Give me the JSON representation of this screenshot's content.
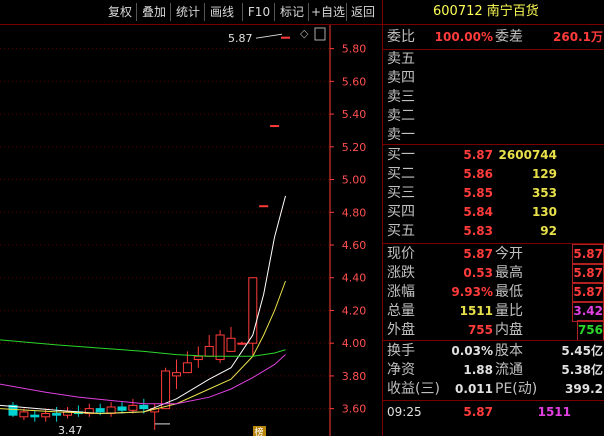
{
  "toolbar": {
    "buttons": [
      "复权",
      "叠加",
      "统计",
      "画线",
      "F10",
      "标记",
      "+自选",
      "返回"
    ]
  },
  "chart": {
    "y_ticks": [
      "5.80",
      "5.60",
      "5.40",
      "5.20",
      "5.00",
      "4.80",
      "4.60",
      "4.40",
      "4.20",
      "4.00",
      "3.80",
      "3.60"
    ],
    "high_label": "5.87",
    "low_label": "3.47",
    "bottom_marker": "榜",
    "colors": {
      "up": "#ff3b3b",
      "down": "#00d2d2",
      "ma1": "#ffffff",
      "ma2": "#e8e04a",
      "ma3": "#e040e0",
      "ma4": "#2bd62b",
      "axis": "#ff3b3b"
    }
  },
  "chart_data": {
    "type": "candlestick",
    "ylim": [
      3.5,
      5.92
    ],
    "candles": [
      {
        "o": 3.62,
        "c": 3.56,
        "h": 3.64,
        "l": 3.55
      },
      {
        "o": 3.55,
        "c": 3.58,
        "h": 3.6,
        "l": 3.53
      },
      {
        "o": 3.56,
        "c": 3.55,
        "h": 3.59,
        "l": 3.52
      },
      {
        "o": 3.55,
        "c": 3.57,
        "h": 3.6,
        "l": 3.52
      },
      {
        "o": 3.57,
        "c": 3.56,
        "h": 3.61,
        "l": 3.52
      },
      {
        "o": 3.56,
        "c": 3.58,
        "h": 3.61,
        "l": 3.54
      },
      {
        "o": 3.58,
        "c": 3.57,
        "h": 3.62,
        "l": 3.55
      },
      {
        "o": 3.57,
        "c": 3.6,
        "h": 3.63,
        "l": 3.55
      },
      {
        "o": 3.6,
        "c": 3.58,
        "h": 3.63,
        "l": 3.56
      },
      {
        "o": 3.57,
        "c": 3.61,
        "h": 3.64,
        "l": 3.55
      },
      {
        "o": 3.61,
        "c": 3.59,
        "h": 3.64,
        "l": 3.57
      },
      {
        "o": 3.59,
        "c": 3.62,
        "h": 3.66,
        "l": 3.57
      },
      {
        "o": 3.62,
        "c": 3.6,
        "h": 3.66,
        "l": 3.57
      },
      {
        "o": 3.58,
        "c": 3.6,
        "h": 3.63,
        "l": 3.47
      },
      {
        "o": 3.6,
        "c": 3.83,
        "h": 3.85,
        "l": 3.6
      },
      {
        "o": 3.8,
        "c": 3.82,
        "h": 3.9,
        "l": 3.72
      },
      {
        "o": 3.82,
        "c": 3.88,
        "h": 3.95,
        "l": 3.82
      },
      {
        "o": 3.9,
        "c": 3.92,
        "h": 3.98,
        "l": 3.85
      },
      {
        "o": 3.92,
        "c": 3.98,
        "h": 4.05,
        "l": 3.92
      },
      {
        "o": 3.9,
        "c": 4.05,
        "h": 4.08,
        "l": 3.88
      },
      {
        "o": 3.95,
        "c": 4.03,
        "h": 4.1,
        "l": 3.95
      },
      {
        "o": 4.0,
        "c": 4.0,
        "h": 4.01,
        "l": 3.99
      },
      {
        "o": 4.0,
        "c": 4.4,
        "h": 4.4,
        "l": 3.92
      },
      {
        "o": 4.84,
        "c": 4.84,
        "h": 4.84,
        "l": 4.84
      },
      {
        "o": 5.33,
        "c": 5.33,
        "h": 5.33,
        "l": 5.33
      },
      {
        "o": 5.87,
        "c": 5.87,
        "h": 5.87,
        "l": 5.87
      }
    ]
  },
  "quote": {
    "code": "600712",
    "name": "南宁百货",
    "weibi_label": "委比",
    "weibi": "100.00%",
    "weicha_label": "委差",
    "weicha": "260.1万",
    "sells": [
      {
        "label": "卖五",
        "price": "",
        "vol": ""
      },
      {
        "label": "卖四",
        "price": "",
        "vol": ""
      },
      {
        "label": "卖三",
        "price": "",
        "vol": ""
      },
      {
        "label": "卖二",
        "price": "",
        "vol": ""
      },
      {
        "label": "卖一",
        "price": "",
        "vol": ""
      }
    ],
    "buys": [
      {
        "label": "买一",
        "price": "5.87",
        "vol": "2600744"
      },
      {
        "label": "买二",
        "price": "5.86",
        "vol": "129"
      },
      {
        "label": "买三",
        "price": "5.85",
        "vol": "353"
      },
      {
        "label": "买四",
        "price": "5.84",
        "vol": "130"
      },
      {
        "label": "买五",
        "price": "5.83",
        "vol": "92"
      }
    ],
    "stats": [
      {
        "l1": "现价",
        "v1": "5.87",
        "l2": "今开",
        "v2": "5.87"
      },
      {
        "l1": "涨跌",
        "v1": "0.53",
        "l2": "最高",
        "v2": "5.87"
      },
      {
        "l1": "涨幅",
        "v1": "9.93%",
        "l2": "最低",
        "v2": "5.87"
      },
      {
        "l1": "总量",
        "v1": "1511",
        "l2": "量比",
        "v2": "3.42"
      },
      {
        "l1": "外盘",
        "v1": "755",
        "l2": "内盘",
        "v2": "756"
      }
    ],
    "stats2": [
      {
        "l1": "换手",
        "v1": "0.03%",
        "l2": "股本",
        "v2": "5.45亿"
      },
      {
        "l1": "净资",
        "v1": "1.88",
        "l2": "流通",
        "v2": "5.38亿"
      },
      {
        "l1": "收益(三)",
        "v1": "0.011",
        "l2": "PE(动)",
        "v2": "399.2"
      }
    ],
    "tick": {
      "time": "09:25",
      "price": "5.87",
      "vol": "1511"
    }
  }
}
